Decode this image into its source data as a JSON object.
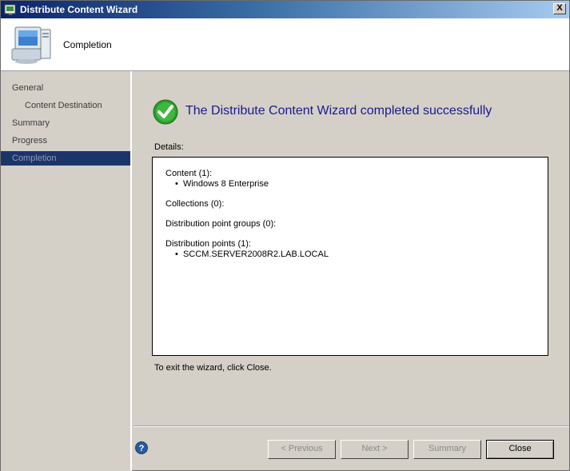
{
  "window": {
    "title": "Distribute Content Wizard",
    "close_label": "X"
  },
  "header": {
    "title": "Completion",
    "icon": "computer-icon"
  },
  "sidebar": {
    "items": [
      {
        "label": "General"
      },
      {
        "label": "Content Destination"
      },
      {
        "label": "Summary"
      },
      {
        "label": "Progress"
      },
      {
        "label": "Completion"
      }
    ],
    "active_index": 4
  },
  "main": {
    "success_message": "The Distribute Content Wizard completed successfully",
    "details_label": "Details:",
    "details": {
      "content_title": "Content (1):",
      "content_items": [
        "Windows 8 Enterprise"
      ],
      "collections_title": "Collections (0):",
      "dp_groups_title": "Distribution point groups (0):",
      "dp_title": "Distribution points (1):",
      "dp_items": [
        "SCCM.SERVER2008R2.LAB.LOCAL"
      ]
    },
    "exit_text": "To exit the wizard, click Close."
  },
  "footer": {
    "previous_label": "< Previous",
    "next_label": "Next >",
    "summary_label": "Summary",
    "close_label": "Close"
  },
  "colors": {
    "accent": "#1c3569",
    "success": "#2e9c2e",
    "heading": "#1a1a8c"
  }
}
